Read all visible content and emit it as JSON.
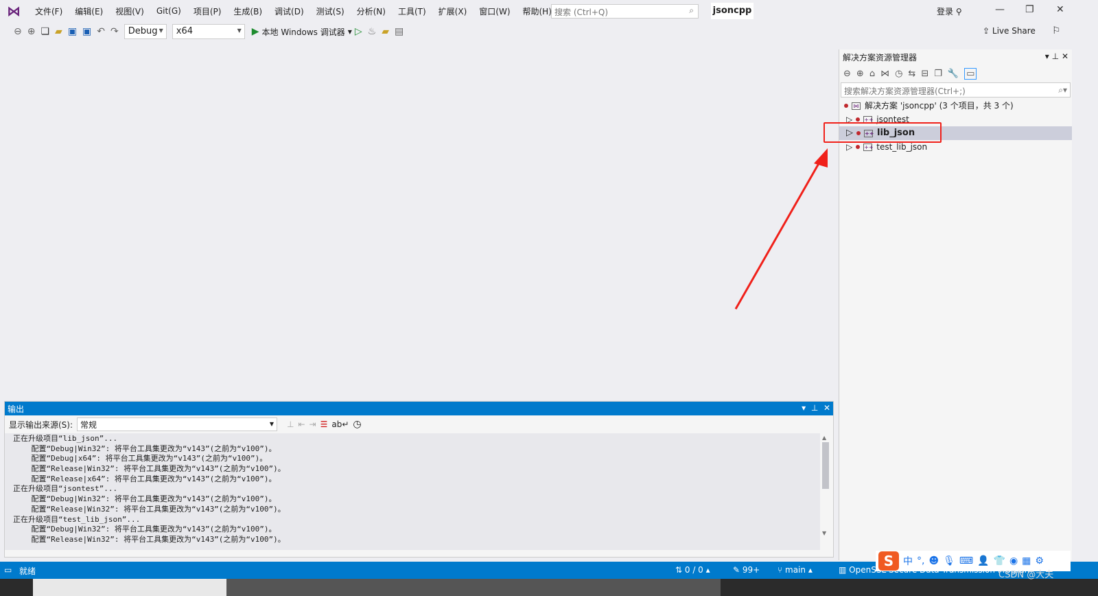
{
  "menubar": {
    "items": [
      "文件(F)",
      "编辑(E)",
      "视图(V)",
      "Git(G)",
      "项目(P)",
      "生成(B)",
      "调试(D)",
      "测试(S)",
      "分析(N)",
      "工具(T)",
      "扩展(X)",
      "窗口(W)",
      "帮助(H)"
    ],
    "search_placeholder": "搜索 (Ctrl+Q)",
    "project_name": "jsoncpp",
    "login": "登录"
  },
  "toolbar": {
    "config": "Debug",
    "platform": "x64",
    "run_label": "本地 Windows 调试器",
    "live_share": "Live Share"
  },
  "solution_explorer": {
    "title": "解决方案资源管理器",
    "search_placeholder": "搜索解决方案资源管理器(Ctrl+;)",
    "solution": "解决方案 'jsoncpp' (3 个项目，共 3 个)",
    "projects": [
      "jsontest",
      "lib_json",
      "test_lib_json"
    ],
    "selected": "lib_json"
  },
  "output": {
    "title": "输出",
    "source_label": "显示输出来源(S):",
    "source_value": "常规",
    "lines": [
      "正在升级项目“lib_json”...",
      "    配置“Debug|Win32”: 将平台工具集更改为“v143”(之前为“v100”)。",
      "    配置“Debug|x64”: 将平台工具集更改为“v143”(之前为“v100”)。",
      "    配置“Release|Win32”: 将平台工具集更改为“v143”(之前为“v100”)。",
      "    配置“Release|x64”: 将平台工具集更改为“v143”(之前为“v100”)。",
      "正在升级项目“jsontest”...",
      "    配置“Debug|Win32”: 将平台工具集更改为“v143”(之前为“v100”)。",
      "    配置“Release|Win32”: 将平台工具集更改为“v143”(之前为“v100”)。",
      "正在升级项目“test_lib_json”...",
      "    配置“Debug|Win32”: 将平台工具集更改为“v143”(之前为“v100”)。",
      "    配置“Release|Win32”: 将平台工具集更改为“v143”(之前为“v100”)。"
    ]
  },
  "status": {
    "ready": "就绪",
    "sync": "0 / 0",
    "changes": "99+",
    "branch": "main",
    "repo": "OpenSSL Secure Data Transmission Program"
  },
  "ime": {
    "lang": "中"
  },
  "watermark": "CSDN @大夫",
  "colors": {
    "accent": "#007acc",
    "annotation": "#f0201a",
    "brand": "#68217a"
  }
}
